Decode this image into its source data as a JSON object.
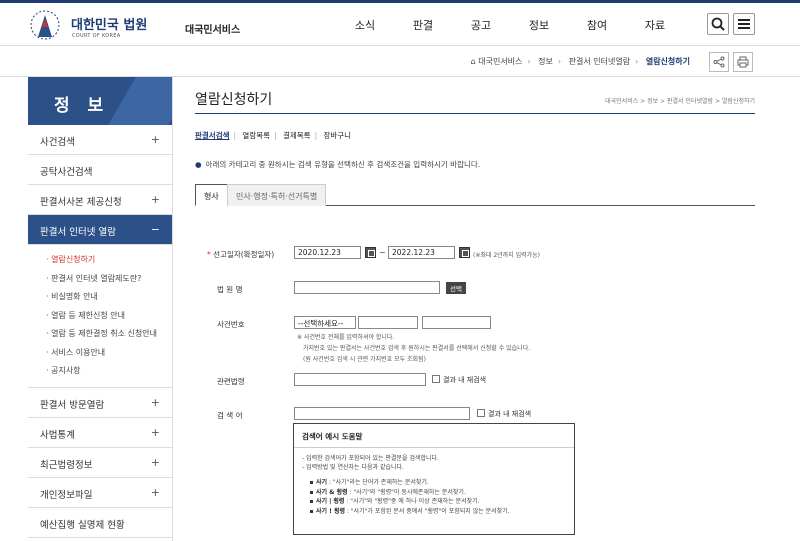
{
  "header": {
    "brand": "대한민국 법원",
    "brand_sub": "COURT OF KOREA",
    "service": "대국민서비스",
    "nav": [
      "소식",
      "판결",
      "공고",
      "정보",
      "참여",
      "자료"
    ]
  },
  "breadcrumb": {
    "items": [
      "대국민서비스",
      "정보",
      "판결서 인터넷열람"
    ],
    "current": "열람신청하기"
  },
  "sidebar": {
    "title": "정 보",
    "items_top": [
      {
        "label": "사건검색",
        "pm": "+"
      },
      {
        "label": "공탁사건검색",
        "pm": ""
      },
      {
        "label": "판결서사본 제공신청",
        "pm": "+"
      }
    ],
    "active": {
      "label": "판결서 인터넷 열람",
      "pm": "−"
    },
    "subitems": [
      "열람신청하기",
      "판결서 인터넷 열람제도란?",
      "비실명화 안내",
      "열람 등 제한신청 안내",
      "열람 등 제한결정 취소 신청안내",
      "서비스 이용안내",
      "공지사항"
    ],
    "items_bottom": [
      {
        "label": "판결서 방문열람",
        "pm": "+"
      },
      {
        "label": "사법통계",
        "pm": "+"
      },
      {
        "label": "최근법령정보",
        "pm": "+"
      },
      {
        "label": "개인정보파일",
        "pm": "+"
      },
      {
        "label": "예산집행 실명제 현황",
        "pm": ""
      }
    ]
  },
  "main": {
    "title": "열람신청하기",
    "crumb": "대국민서비스 > 정보 > 판결서 인터넷열람 > 열람신청하기",
    "subnav": [
      "판결서검색",
      "열람목록",
      "결제목록",
      "장바구니"
    ],
    "notice": "아래의 카테고리 중 원하시는 검색 유형을 선택하신 후 검색조건을 입력하시기 바랍니다.",
    "tabs": [
      "형사",
      "민사·행정·특허·선거특별"
    ],
    "form": {
      "date_label": "선고일자(확정일자)",
      "date_from": "2020.12.23",
      "date_to": "2022.12.23",
      "date_hint": "(※최대 2년까지 입력가능)",
      "court_label": "법 원 명",
      "court_btn": "선택",
      "case_label": "사건번호",
      "case_select": "--선택하세요--",
      "case_note1": "※ 사건번호 전체를 입력하셔야 합니다.",
      "case_note2": "가지번호 있는 판결서는 사건번호 검색 후 원하시는 판결서를 선택해서 신청할 수 있습니다.",
      "case_note3": "(원 사건번호 검색 시 관련 가지번호 모두 조회됨)",
      "law_label": "관련법령",
      "recheck": "결과 내 재검색",
      "kw_label": "검 색 어"
    },
    "help": {
      "title": "검색어 예시 도움말",
      "lines": [
        "- 입력한 검색어가 포함되어 있는 판결문을 검색합니다.",
        "- 입력방법 및 연산자는 다음과 같습니다."
      ],
      "ops": [
        {
          "k": "사기",
          "d": ": \"사기\"라는 단어가 존재하는 문서찾기."
        },
        {
          "k": "사기 & 횡령",
          "d": ": \"사기\"와 \"횡령\"이 동시에존재하는 문서찾기."
        },
        {
          "k": "사기 | 횡령",
          "d": ": \"사기\"와 \"횡령\"중 에 하나 이상 존재하는 문서찾기."
        },
        {
          "k": "사기 ! 횡령",
          "d": ": \"사기\"가 포함된 문서 중에서 \"횡령\"이 포함되지 않는 문서찾기."
        }
      ]
    }
  },
  "colors": {
    "primary": "#1e3c73",
    "accent": "#2c5188",
    "required": "#d0332c"
  }
}
